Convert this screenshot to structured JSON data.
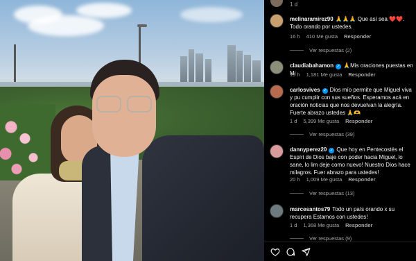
{
  "top": {
    "date": "1 d"
  },
  "comments": [
    {
      "username": "melinaramirez90",
      "verified": false,
      "text": "🙏🙏🙏 Que así sea ❤️❤️. Todo orando por ustedes.",
      "time": "16 h",
      "likes": "410 Me gusta",
      "reply": "Responder",
      "replies": "Ver respuestas (2)",
      "avatar_color": "#c8a070"
    },
    {
      "username": "claudiabahamon",
      "verified": true,
      "text": "🙏Mis oraciones puestas en Mi",
      "time": "19 h",
      "likes": "1,181 Me gusta",
      "reply": "Responder",
      "replies": "",
      "avatar_color": "#8a8f7a"
    },
    {
      "username": "carlosvives",
      "verified": true,
      "text": "Dios mío permite que Miguel viva y pu cumplir con sus sueños. Esperamos acá en oración noticias que nos devuelvan la alegría. Fuerte abrazo ustedes 🙏🫶",
      "time": "1 d",
      "likes": "5,399 Me gusta",
      "reply": "Responder",
      "replies": "Ver respuestas (39)",
      "avatar_color": "#b86a4e"
    },
    {
      "username": "dannyperez20",
      "verified": true,
      "text": "Que hoy en Pentecostés el Espíri de Dios baje con poder hacia Miguel, lo sane, lo lim deje como nuevo! Nuestro Dios hace milagros. Fuer abrazo para ustedes!",
      "time": "20 h",
      "likes": "1,009 Me gusta",
      "reply": "Responder",
      "replies": "Ver respuestas (13)",
      "avatar_color": "#d89a9a"
    },
    {
      "username": "marcesantos79",
      "verified": false,
      "text": "Todo un país orando x su recupera Estamos con ustedes!",
      "time": "1 d",
      "likes": "1,368 Me gusta",
      "reply": "Responder",
      "replies": "Ver respuestas (9)",
      "avatar_color": "#6d7a80"
    }
  ],
  "actions": {
    "like_icon": "heart-icon",
    "comment_icon": "comment-icon",
    "share_icon": "share-icon"
  }
}
